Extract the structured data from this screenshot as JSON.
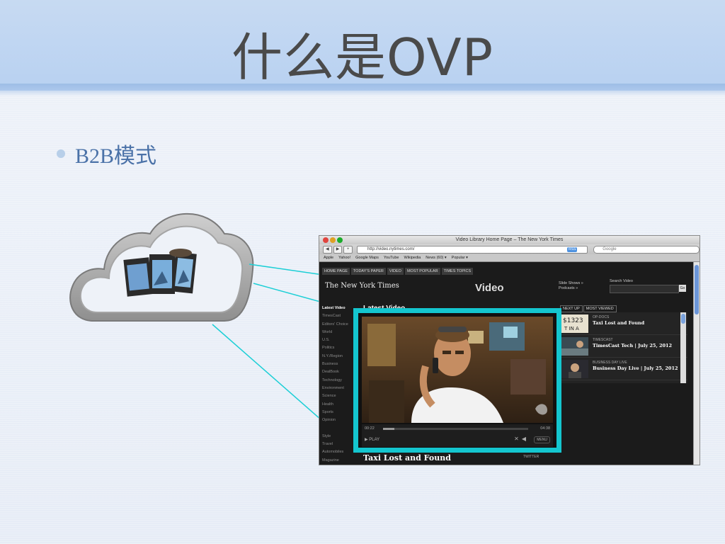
{
  "slide": {
    "title": "什么是OVP",
    "bullet": "B2B模式"
  },
  "colors": {
    "title_band": "#bcd4f2",
    "bullet_text": "#4b72a8",
    "highlight": "#14c6cf",
    "connector": "#1ccfd6"
  },
  "cloud": {
    "icon": "film-strip-icon"
  },
  "browser": {
    "window_title": "Video Library Home Page – The New York Times",
    "url": "http://video.nytimes.com/",
    "rss_label": "RSS",
    "search_placeholder": "Google",
    "bookmarks": [
      "Apple",
      "Yahoo!",
      "Google Maps",
      "YouTube",
      "Wikipedia",
      "News (60) ▾",
      "Popular ▾"
    ],
    "nav_tabs": [
      "HOME PAGE",
      "TODAY'S PAPER",
      "VIDEO",
      "MOST POPULAR",
      "TIMES TOPICS"
    ],
    "logo": "The New York Times",
    "section_title": "Video",
    "header_links": [
      "Slide Shows »",
      "Podcasts »"
    ],
    "search_label": "Search Video",
    "go_label": "Go",
    "sidebar": [
      "Latest Video",
      "TimesCast",
      "Editors' Choice",
      "World",
      "U.S.",
      "Politics",
      "N.Y./Region",
      "Business",
      "DealBook",
      "Technology",
      "Environment",
      "Science",
      "Health",
      "Sports",
      "Opinion",
      "",
      "Style",
      "Travel",
      "Automobiles",
      "Magazine"
    ],
    "latest_video_heading": "Latest Video",
    "video_caption": "Taxi Lost and Found",
    "list_tabs": [
      "NEXT UP",
      "MOST VIEWED"
    ],
    "list_items": [
      {
        "kicker": "OP-DOCS",
        "title": "Taxi Lost and Found"
      },
      {
        "kicker": "TIMESCAST",
        "title": "TimesCast Tech | July 25, 2012"
      },
      {
        "kicker": "BUSINESS DAY LIVE",
        "title": "Business Day Live | July 25, 2012"
      }
    ],
    "twitter_label": "TWITTER"
  },
  "player": {
    "elapsed": "00:22",
    "duration": "04:38",
    "progress": 0.08,
    "play_label": "▶ PLAY",
    "menu_label": "MENU"
  }
}
